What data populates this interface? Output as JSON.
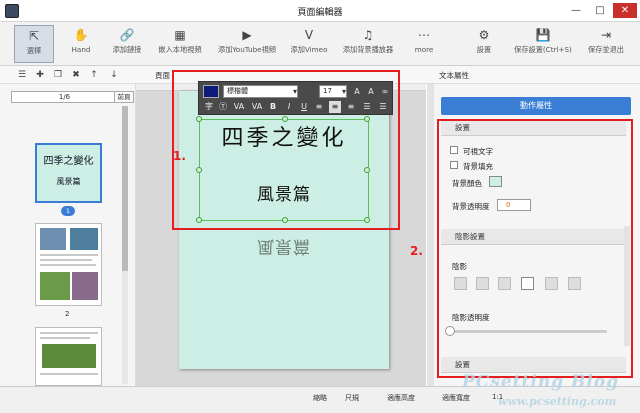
{
  "window": {
    "title": "頁面編輯器",
    "minimize": "—",
    "maximize": "□",
    "close": "✕"
  },
  "toolbar": [
    {
      "label": "選擇",
      "icon": "⇱"
    },
    {
      "label": "Hand",
      "icon": "✋"
    },
    {
      "label": "添加鏈接",
      "icon": "🔗"
    },
    {
      "label": "嵌入本地視頻",
      "icon": "▦"
    },
    {
      "label": "添加YouTube視頻",
      "icon": "▶"
    },
    {
      "label": "添加Vimeo",
      "icon": "V"
    },
    {
      "label": "添加背景播放器",
      "icon": "♫"
    },
    {
      "label": "more",
      "icon": "⋯"
    },
    {
      "label": "設置",
      "icon": "⚙"
    },
    {
      "label": "保存設置(Ctrl+S)",
      "icon": "💾"
    },
    {
      "label": "保存並退出",
      "icon": "⇥"
    }
  ],
  "subtabs": {
    "page": "頁面",
    "props": "文本屬性"
  },
  "sidebar": {
    "page_counter": "1/6",
    "go": "前頁",
    "thumb1_title": "四季之變化",
    "thumb1_sub": "風景篇",
    "page1": "1",
    "page2": "2"
  },
  "text_toolbar": {
    "font": "標楷體",
    "size": "17"
  },
  "canvas": {
    "heading": "四季之變化",
    "subheading": "風景篇",
    "reflection": "風景篇"
  },
  "annotations": {
    "one": "1.",
    "two": "2."
  },
  "panel": {
    "anim_button": "動作屬性",
    "section_settings": "設置",
    "visible_text": "可視文字",
    "bg_color_cb": "背景填充",
    "bg_color": "背景顏色",
    "bg_opacity": "背景透明度",
    "bg_opacity_value": "0",
    "shadow_section": "陰影設置",
    "shadow": "陰影",
    "shadow_opacity": "陰影透明度",
    "bottom_section": "設置"
  },
  "status": {
    "thumb": "縮略",
    "fit": "尺規",
    "fit_width": "適應高度",
    "fit_page": "適應寬度",
    "zoom": "1:1"
  },
  "watermark": {
    "text": "PCsetting Blog",
    "url": "www.pcsetting.com"
  }
}
